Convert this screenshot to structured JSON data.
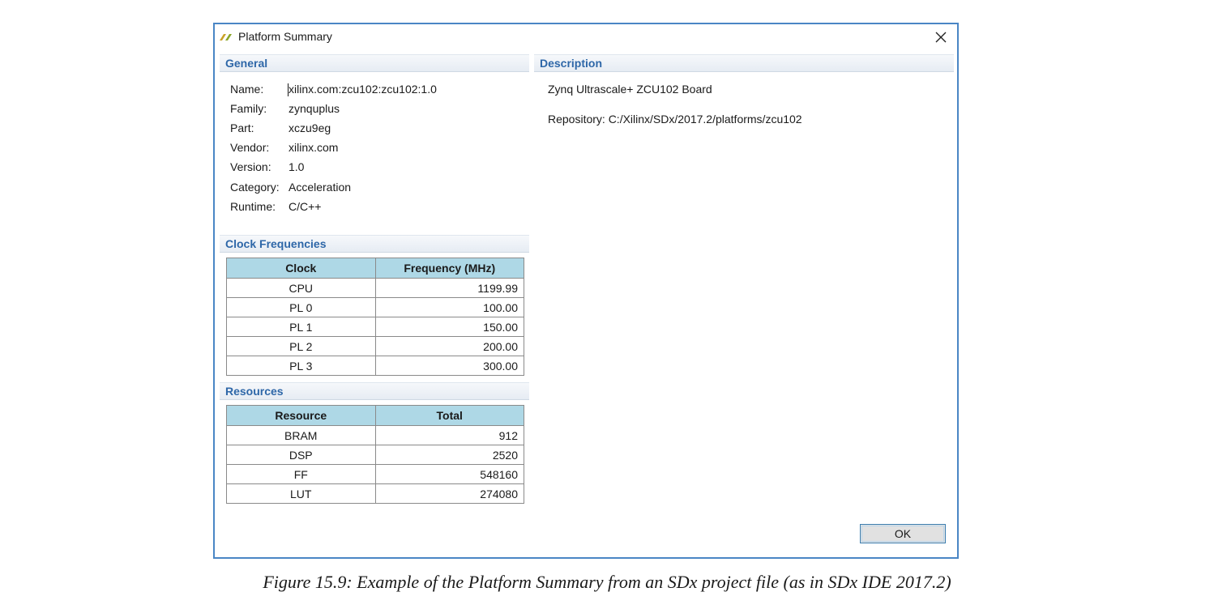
{
  "window": {
    "title": "Platform Summary",
    "close_label": "✕"
  },
  "general": {
    "header": "General",
    "fields": [
      {
        "label": "Name:",
        "value": "xilinx.com:zcu102:zcu102:1.0"
      },
      {
        "label": "Family:",
        "value": "zynquplus"
      },
      {
        "label": "Part:",
        "value": "xczu9eg"
      },
      {
        "label": "Vendor:",
        "value": "xilinx.com"
      },
      {
        "label": "Version:",
        "value": "1.0"
      },
      {
        "label": "Category:",
        "value": "Acceleration"
      },
      {
        "label": "Runtime:",
        "value": "C/C++"
      }
    ]
  },
  "description": {
    "header": "Description",
    "board": "Zynq Ultrascale+ ZCU102 Board",
    "repository": "Repository: C:/Xilinx/SDx/2017.2/platforms/zcu102"
  },
  "clocks": {
    "header": "Clock Frequencies",
    "columns": [
      "Clock",
      "Frequency (MHz)"
    ],
    "rows": [
      [
        "CPU",
        "1199.99"
      ],
      [
        "PL 0",
        "100.00"
      ],
      [
        "PL 1",
        "150.00"
      ],
      [
        "PL 2",
        "200.00"
      ],
      [
        "PL 3",
        "300.00"
      ]
    ]
  },
  "resources": {
    "header": "Resources",
    "columns": [
      "Resource",
      "Total"
    ],
    "rows": [
      [
        "BRAM",
        "912"
      ],
      [
        "DSP",
        "2520"
      ],
      [
        "FF",
        "548160"
      ],
      [
        "LUT",
        "274080"
      ]
    ]
  },
  "buttons": {
    "ok": "OK"
  },
  "caption": "Figure 15.9:  Example of the Platform Summary from an SDx project file (as in SDx IDE 2017.2)",
  "colors": {
    "accent": "#2e67a8",
    "table_header_bg": "#aed8e6",
    "window_border": "#4a86c5"
  }
}
